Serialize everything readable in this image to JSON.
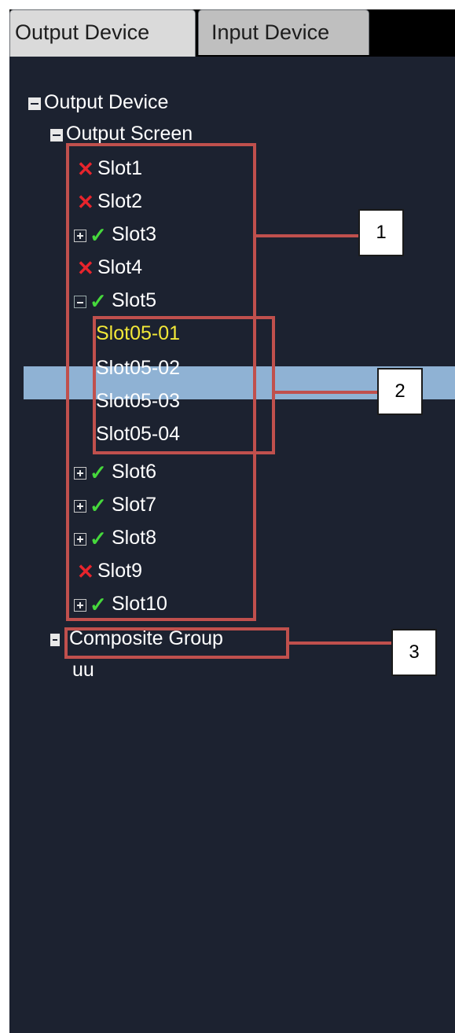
{
  "tabs": [
    {
      "label": "Output Device",
      "active": true
    },
    {
      "label": "Input Device",
      "active": false
    }
  ],
  "tree": {
    "root_label": "Output Device",
    "screen_label": "Output Screen",
    "slots": [
      {
        "label": "Slot1",
        "status": "error"
      },
      {
        "label": "Slot2",
        "status": "error"
      },
      {
        "label": "Slot3",
        "status": "ok",
        "expander": "plus"
      },
      {
        "label": "Slot4",
        "status": "error"
      },
      {
        "label": "Slot5",
        "status": "ok",
        "expander": "minus"
      },
      {
        "label": "Slot6",
        "status": "ok",
        "expander": "plus"
      },
      {
        "label": "Slot7",
        "status": "ok",
        "expander": "plus"
      },
      {
        "label": "Slot8",
        "status": "ok",
        "expander": "plus"
      },
      {
        "label": "Slot9",
        "status": "error"
      },
      {
        "label": "Slot10",
        "status": "ok",
        "expander": "plus"
      }
    ],
    "slot5_children": [
      "Slot05-01",
      "Slot05-02",
      "Slot05-03",
      "Slot05-04"
    ],
    "selected": "Slot05-01",
    "composite_label": "Composite Group",
    "composite_children": [
      "uu"
    ]
  },
  "annotations": [
    "1",
    "2",
    "3"
  ],
  "colors": {
    "panel_bg": "#1c2230",
    "selection": "#8fb2d4",
    "selected_text": "#f2e838",
    "error": "#e8242c",
    "ok": "#46d83c",
    "annotation": "#c0504d"
  },
  "icons": {
    "error": "x-mark-icon",
    "ok": "check-mark-icon",
    "expand": "plus-box-icon",
    "collapse": "minus-box-icon"
  }
}
